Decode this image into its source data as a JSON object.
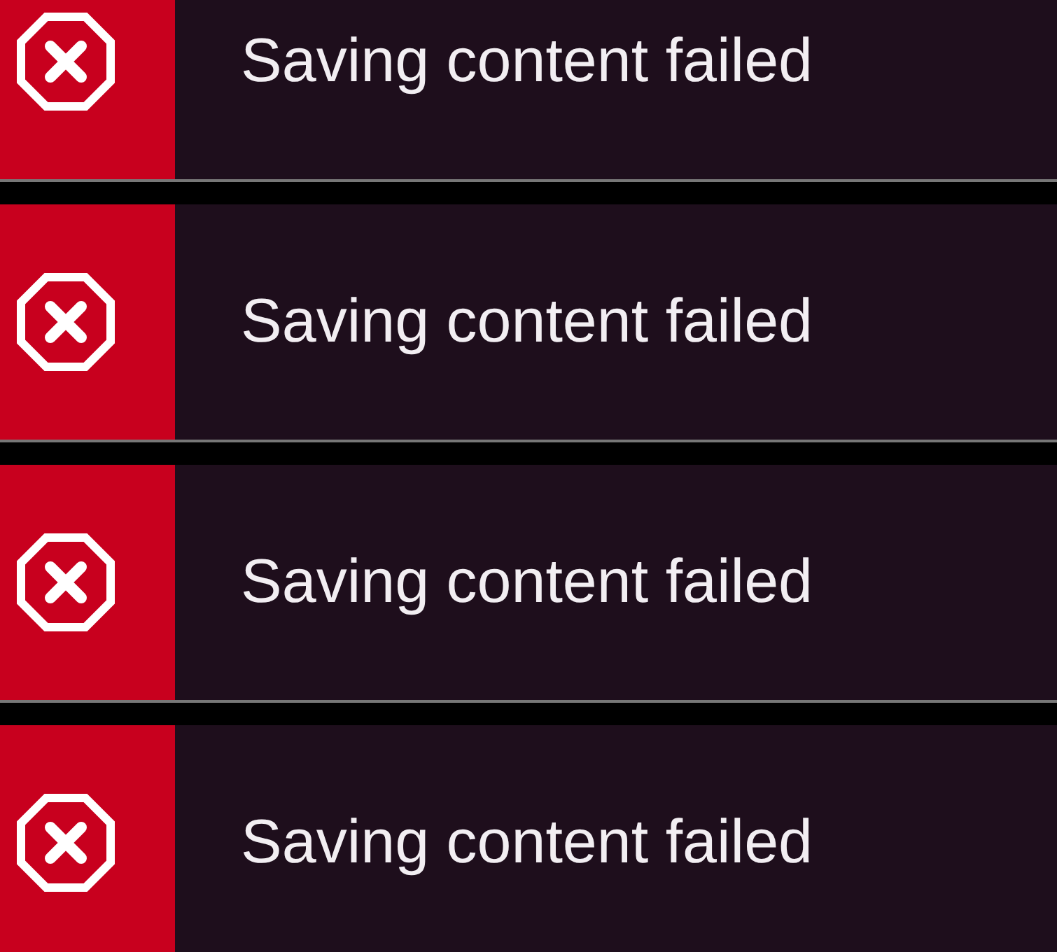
{
  "toasts": [
    {
      "kind": "error",
      "message": "Saving content failed"
    },
    {
      "kind": "error",
      "message": "Saving content failed"
    },
    {
      "kind": "error",
      "message": "Saving content failed"
    },
    {
      "kind": "error",
      "message": "Saving content failed"
    }
  ]
}
